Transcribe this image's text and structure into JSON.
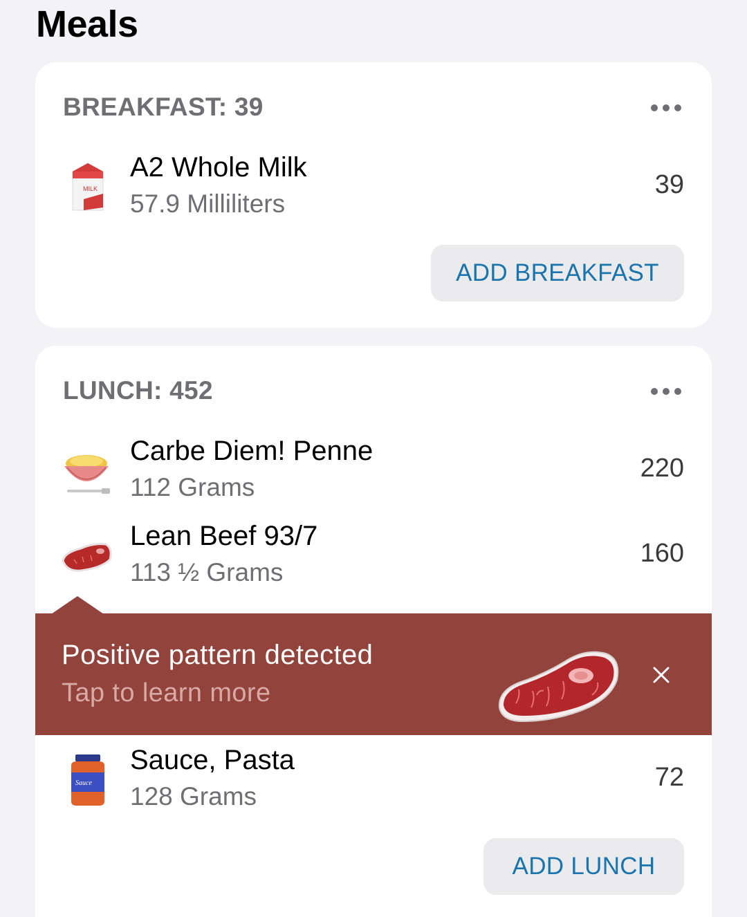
{
  "page": {
    "title": "Meals"
  },
  "breakfast": {
    "header": "BREAKFAST: 39",
    "items": [
      {
        "name": "A2 Whole Milk",
        "qty": "57.9 Milliliters",
        "cal": "39",
        "icon": "milk-carton-icon",
        "icon_label": "MILK"
      }
    ],
    "add_label": "ADD BREAKFAST"
  },
  "lunch": {
    "header": "LUNCH: 452",
    "items": [
      {
        "name": "Carbe Diem! Penne",
        "qty": "112 Grams",
        "cal": "220",
        "icon": "pasta-bowl-icon"
      },
      {
        "name": "Lean Beef 93/7",
        "qty": "113 ½ Grams",
        "cal": "160",
        "icon": "steak-icon"
      },
      {
        "name": "Sauce, Pasta",
        "qty": "128 Grams",
        "cal": "72",
        "icon": "sauce-jar-icon",
        "icon_label": "Sauce"
      }
    ],
    "add_label": "ADD LUNCH"
  },
  "banner": {
    "title": "Positive pattern detected",
    "subtitle": "Tap to learn more",
    "icon": "steak-icon"
  },
  "colors": {
    "background": "#f2f2f7",
    "banner": "#92433c",
    "accent": "#1a74ad",
    "secondary_text": "#6e6e73"
  }
}
